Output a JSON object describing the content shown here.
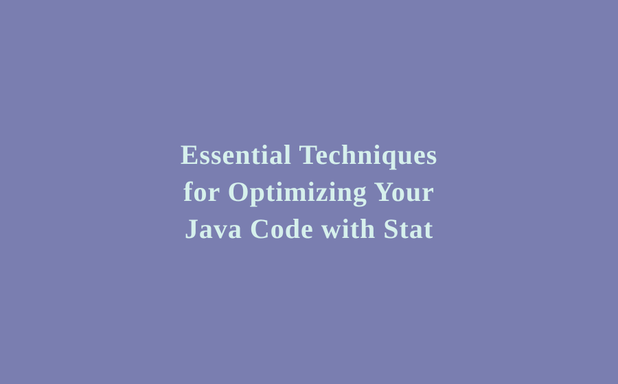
{
  "title": {
    "line1": "Essential Techniques",
    "line2": "for Optimizing Your",
    "line3": "Java Code with Stat"
  },
  "colors": {
    "background": "#7a7eb0",
    "text": "#d6f0ec"
  }
}
